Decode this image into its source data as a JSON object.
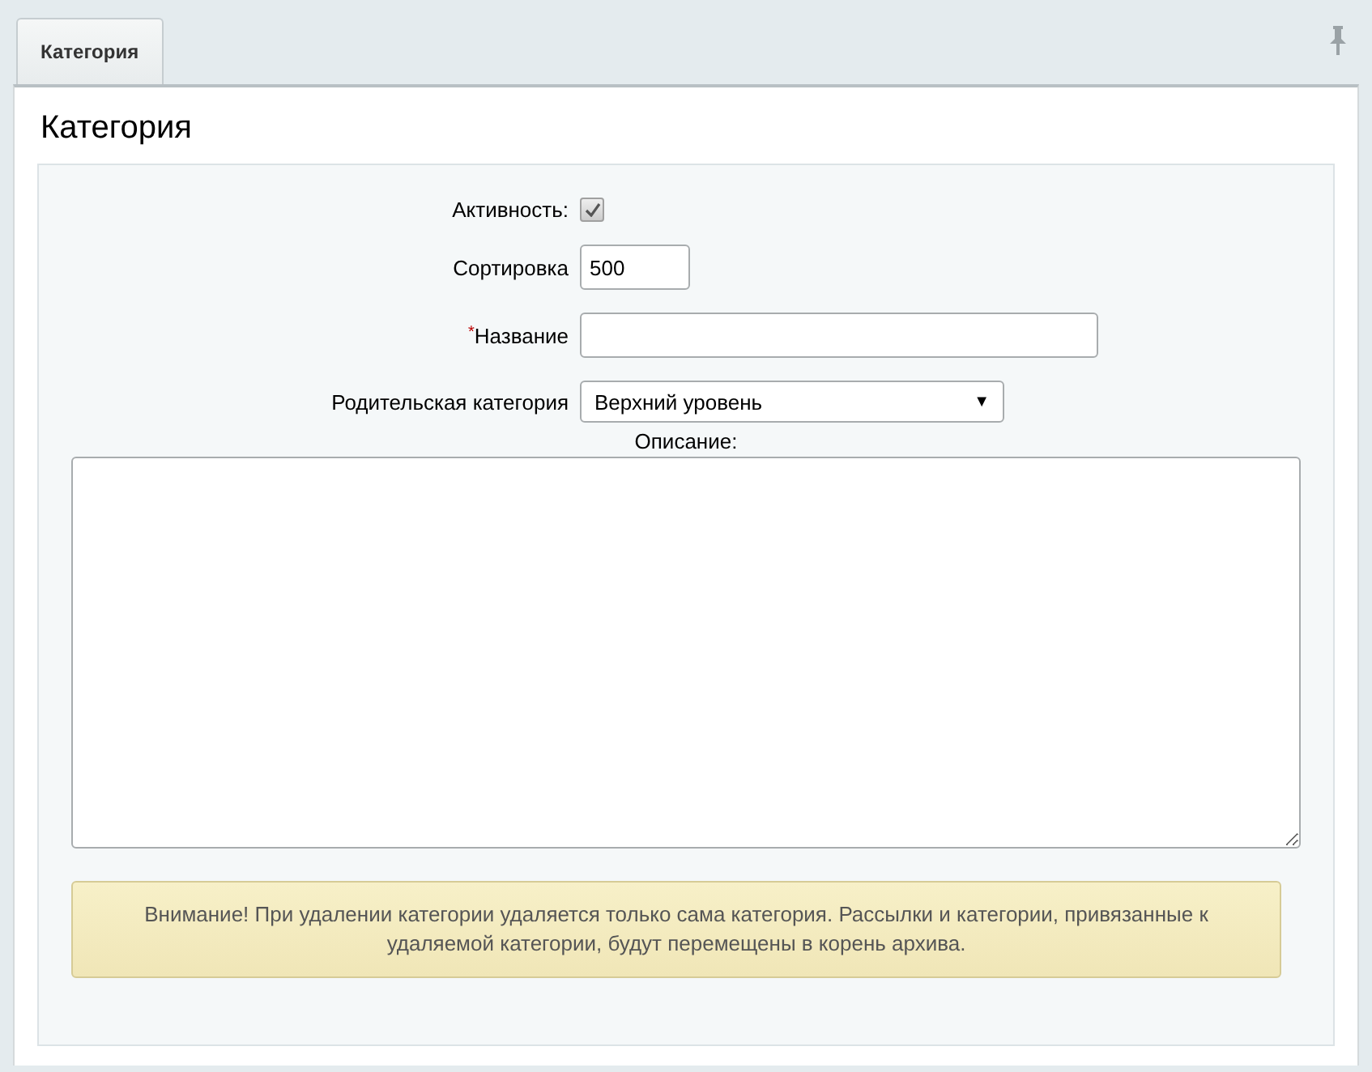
{
  "tabs": [
    {
      "label": "Категория",
      "selected": true
    }
  ],
  "panel": {
    "title": "Категория"
  },
  "fields": [
    {
      "kind": "checkbox",
      "label": "Активность:",
      "checked": true
    },
    {
      "kind": "short_text",
      "label": "Сортировка",
      "value": "500"
    },
    {
      "kind": "long_text",
      "label": "Название",
      "required": true,
      "required_mark": "*"
    },
    {
      "kind": "select",
      "label": "Родительская категория",
      "value": "Верхний уровень",
      "arrow": "▼"
    }
  ],
  "description": {
    "label": "Описание:"
  },
  "notice": "Внимание! При удалении категории удаляется только сама категория. Рассылки и категории, привязанные к удаляемой категории, будут перемещены в корень архива."
}
